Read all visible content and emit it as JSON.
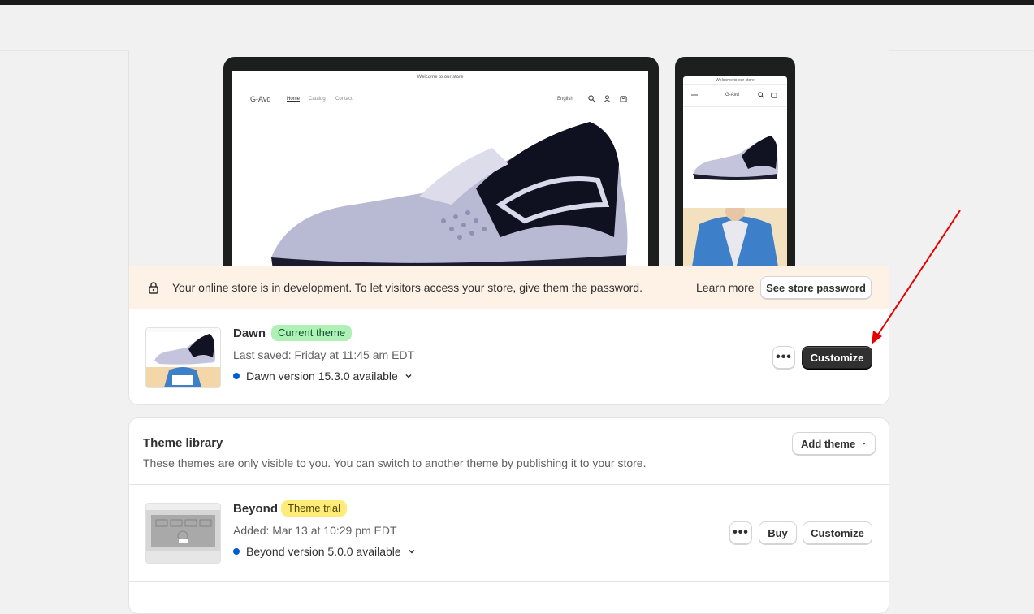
{
  "preview": {
    "desktop": {
      "announcement": "Welcome to our store",
      "logo": "G-Avd",
      "nav": [
        "Home",
        "Catalog",
        "Contact"
      ],
      "language": "English",
      "icons": [
        "search-icon",
        "account-icon",
        "cart-icon"
      ]
    },
    "mobile": {
      "announcement": "Welcome to our store",
      "logo": "G-Avd",
      "icons": [
        "menu-icon",
        "search-icon",
        "cart-icon"
      ]
    }
  },
  "banner": {
    "icon": "lock-icon",
    "message": "Your online store is in development. To let visitors access your store, give them the password.",
    "learn_more": "Learn more",
    "button": "See store password",
    "background": "#fef1e6"
  },
  "current_theme": {
    "name": "Dawn",
    "badge": "Current theme",
    "last_saved": "Last saved: Friday at 11:45 am EDT",
    "version": "Dawn version 15.3.0 available",
    "more_label": "•••",
    "customize": "Customize"
  },
  "library": {
    "title": "Theme library",
    "subtitle": "These themes are only visible to you. You can switch to another theme by publishing it to your store.",
    "add_theme": "Add theme",
    "themes": [
      {
        "name": "Beyond",
        "badge": "Theme trial",
        "added": "Added: Mar 13 at 10:29 pm EDT",
        "version": "Beyond version 5.0.0 available",
        "more_label": "•••",
        "buy": "Buy",
        "customize": "Customize"
      }
    ]
  },
  "colors": {
    "primary_button": "#303030",
    "info_dot": "#005bd3",
    "success_badge": "#aff0b5",
    "warning_badge": "#ffeb78",
    "annotation_arrow": "#e60000"
  }
}
